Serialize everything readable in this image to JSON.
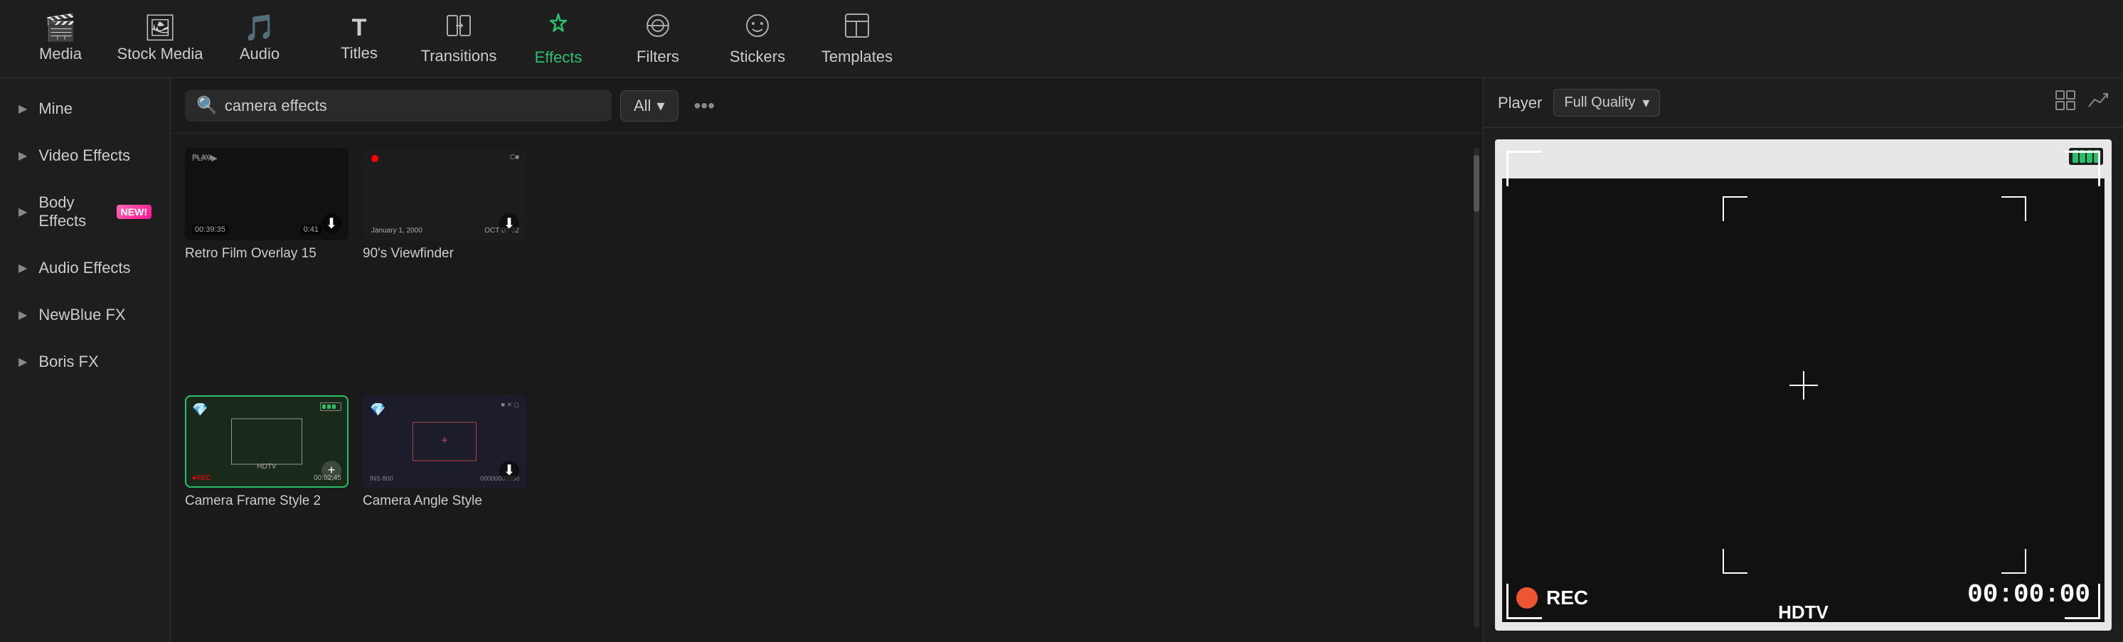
{
  "nav": {
    "items": [
      {
        "id": "media",
        "label": "Media",
        "icon": "🎬",
        "active": false
      },
      {
        "id": "stock-media",
        "label": "Stock Media",
        "icon": "🖼",
        "active": false
      },
      {
        "id": "audio",
        "label": "Audio",
        "icon": "🎵",
        "active": false
      },
      {
        "id": "titles",
        "label": "Titles",
        "icon": "T",
        "active": false
      },
      {
        "id": "transitions",
        "label": "Transitions",
        "icon": "▷",
        "active": false
      },
      {
        "id": "effects",
        "label": "Effects",
        "icon": "✦",
        "active": true
      },
      {
        "id": "filters",
        "label": "Filters",
        "icon": "◎",
        "active": false
      },
      {
        "id": "stickers",
        "label": "Stickers",
        "icon": "☺",
        "active": false
      },
      {
        "id": "templates",
        "label": "Templates",
        "icon": "▣",
        "active": false
      }
    ]
  },
  "sidebar": {
    "items": [
      {
        "id": "mine",
        "label": "Mine"
      },
      {
        "id": "video-effects",
        "label": "Video Effects"
      },
      {
        "id": "body-effects",
        "label": "Body Effects",
        "badge": "NEW!"
      },
      {
        "id": "audio-effects",
        "label": "Audio Effects"
      },
      {
        "id": "newblue-fx",
        "label": "NewBlue FX"
      },
      {
        "id": "boris-fx",
        "label": "Boris FX"
      }
    ]
  },
  "search": {
    "placeholder": "camera effects",
    "value": "camera effects"
  },
  "filter": {
    "label": "All",
    "chevron": "▾"
  },
  "more_label": "•••",
  "effects": [
    {
      "id": "retro-film",
      "label": "Retro Film Overlay 15",
      "selected": false,
      "time1": "00:39:35",
      "time2": "0:41"
    },
    {
      "id": "viewfinder-90s",
      "label": "90's Viewfinder",
      "selected": false
    },
    {
      "id": "camera-frame-1",
      "label": "Camera Frame Style 2",
      "selected": true
    },
    {
      "id": "camera-frame-2",
      "label": "Camera Angle Style",
      "selected": false
    }
  ],
  "player": {
    "label": "Player",
    "quality": "Full Quality",
    "grid_icon": "⊞",
    "chart_icon": "📈",
    "rec_label": "REC",
    "time": "00:00:00",
    "hdtv_label": "HDTV",
    "battery_bars": [
      true,
      true,
      true,
      true
    ],
    "battery_colors": [
      "#2dbe6c",
      "#2dbe6c",
      "#2dbe6c",
      "#2dbe6c"
    ]
  }
}
